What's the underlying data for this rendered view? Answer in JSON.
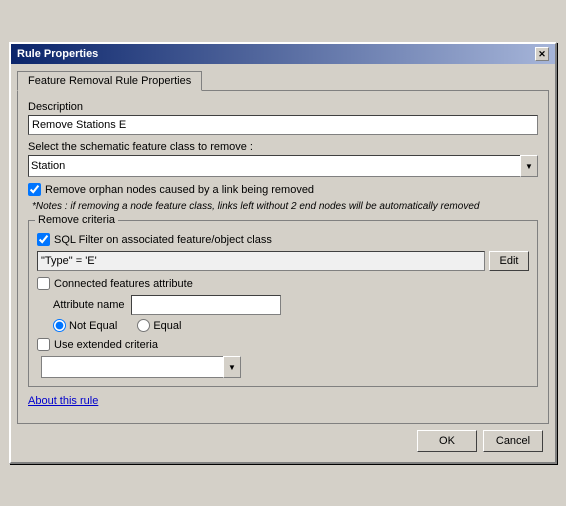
{
  "window": {
    "title": "Rule Properties",
    "close_btn": "✕"
  },
  "tab": {
    "label": "Feature Removal Rule Properties"
  },
  "form": {
    "description_label": "Description",
    "description_value": "Remove Stations E",
    "feature_class_label": "Select the schematic feature class to remove :",
    "feature_class_value": "Station",
    "remove_orphan_label": "Remove orphan nodes caused by a link being removed",
    "note_text": "*Notes : if removing a node feature class, links left without 2 end nodes will be automatically removed",
    "remove_criteria_title": "Remove criteria",
    "sql_filter_label": "SQL Filter on associated feature/object class",
    "sql_value": "\"Type\" = 'E'",
    "edit_btn": "Edit",
    "connected_features_label": "Connected features attribute",
    "attribute_name_label": "Attribute name",
    "attribute_name_value": "",
    "not_equal_label": "Not Equal",
    "equal_label": "Equal",
    "use_extended_label": "Use extended criteria",
    "extended_dropdown_value": ""
  },
  "about": {
    "link_text": "About this rule"
  },
  "footer": {
    "ok_label": "OK",
    "cancel_label": "Cancel"
  }
}
